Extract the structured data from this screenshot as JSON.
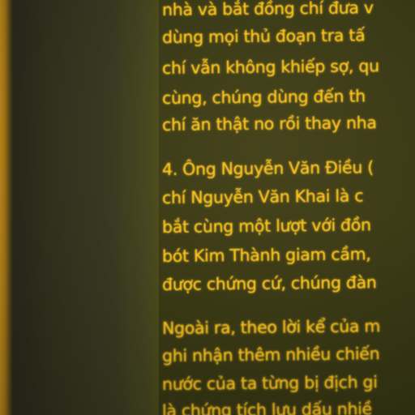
{
  "paragraph_1": {
    "lines": [
      "nhà và bắt đồng chí đưa v",
      "dùng mọi thủ đoạn tra tấ",
      "chí vẫn không khiếp sợ, qu",
      "cùng, chúng dùng đến th",
      "chí ăn thật no rồi thay nha"
    ]
  },
  "paragraph_2": {
    "lines": [
      "4. Ông Nguyễn Văn Điều (",
      "chí Nguyễn Văn Khai là c",
      "bắt cùng một lượt với đồn",
      "bót Kim Thành giam cầm,",
      "được chứng cứ, chúng đàn"
    ]
  },
  "paragraph_3": {
    "lines": [
      "Ngoài ra, theo lời kể của m",
      "ghi nhận thêm nhiều chiến",
      "nước của ta từng bị địch gi",
      "là chứng tích lưu dấu nhiề"
    ]
  },
  "colors": {
    "text": "#f8c21a",
    "panel": "#3a3a17",
    "frame_edge": "#c89420"
  }
}
